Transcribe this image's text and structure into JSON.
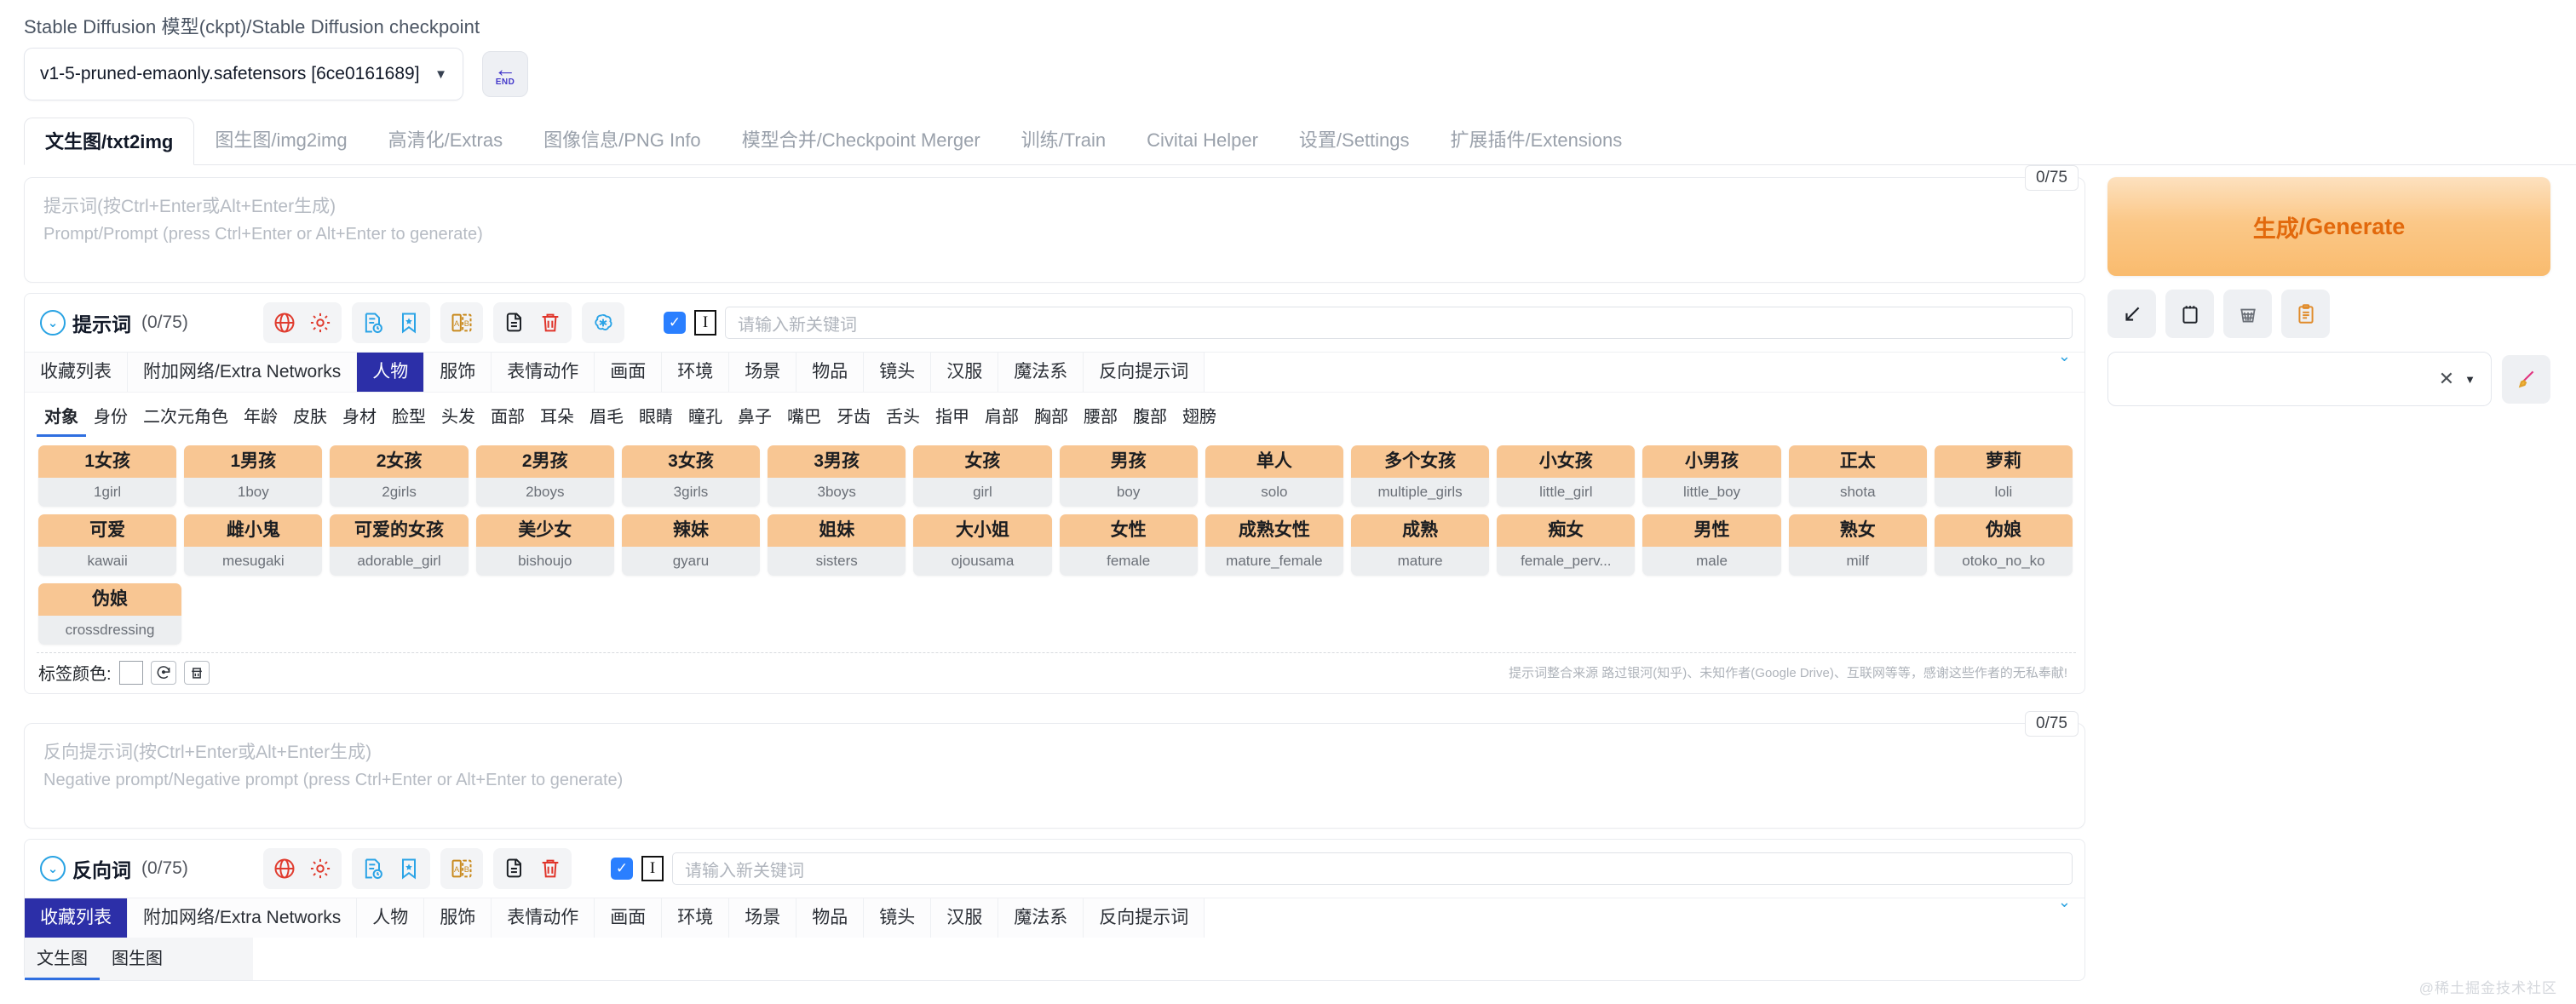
{
  "checkpoint": {
    "label": "Stable Diffusion 模型(ckpt)/Stable Diffusion checkpoint",
    "value": "v1-5-pruned-emaonly.safetensors [6ce0161689]",
    "caret": "▼",
    "end_button": {
      "arrow": "←",
      "text": "END"
    }
  },
  "main_tabs": [
    {
      "label": "文生图/txt2img",
      "active": true
    },
    {
      "label": "图生图/img2img",
      "active": false
    },
    {
      "label": "高清化/Extras",
      "active": false
    },
    {
      "label": "图像信息/PNG Info",
      "active": false
    },
    {
      "label": "模型合并/Checkpoint Merger",
      "active": false
    },
    {
      "label": "训练/Train",
      "active": false
    },
    {
      "label": "Civitai Helper",
      "active": false
    },
    {
      "label": "设置/Settings",
      "active": false
    },
    {
      "label": "扩展插件/Extensions",
      "active": false
    }
  ],
  "prompt": {
    "token_badge": "0/75",
    "placeholder_zh": "提示词(按Ctrl+Enter或Alt+Enter生成)",
    "placeholder_en": "Prompt/Prompt (press Ctrl+Enter or Alt+Enter to generate)",
    "value": ""
  },
  "negative_prompt": {
    "token_badge": "0/75",
    "placeholder_zh": "反向提示词(按Ctrl+Enter或Alt+Enter生成)",
    "placeholder_en": "Negative prompt/Negative prompt (press Ctrl+Enter or Alt+Enter to generate)",
    "value": ""
  },
  "prompt_panel": {
    "title": "提示词",
    "count": "(0/75)",
    "keyword_placeholder": "请输入新关键词",
    "keyword_value": "",
    "checkbox_checked": true
  },
  "negative_panel": {
    "title": "反向词",
    "count": "(0/75)",
    "keyword_placeholder": "请输入新关键词",
    "keyword_value": "",
    "checkbox_checked": true
  },
  "category_tabs": [
    {
      "label": "收藏列表",
      "active": false
    },
    {
      "label": "附加网络/Extra Networks",
      "active": false
    },
    {
      "label": "人物",
      "active": true
    },
    {
      "label": "服饰",
      "active": false
    },
    {
      "label": "表情动作",
      "active": false
    },
    {
      "label": "画面",
      "active": false
    },
    {
      "label": "环境",
      "active": false
    },
    {
      "label": "场景",
      "active": false
    },
    {
      "label": "物品",
      "active": false
    },
    {
      "label": "镜头",
      "active": false
    },
    {
      "label": "汉服",
      "active": false
    },
    {
      "label": "魔法系",
      "active": false
    },
    {
      "label": "反向提示词",
      "active": false
    }
  ],
  "negative_category_tabs": [
    {
      "label": "收藏列表",
      "active": true
    },
    {
      "label": "附加网络/Extra Networks",
      "active": false
    },
    {
      "label": "人物",
      "active": false
    },
    {
      "label": "服饰",
      "active": false
    },
    {
      "label": "表情动作",
      "active": false
    },
    {
      "label": "画面",
      "active": false
    },
    {
      "label": "环境",
      "active": false
    },
    {
      "label": "场景",
      "active": false
    },
    {
      "label": "物品",
      "active": false
    },
    {
      "label": "镜头",
      "active": false
    },
    {
      "label": "汉服",
      "active": false
    },
    {
      "label": "魔法系",
      "active": false
    },
    {
      "label": "反向提示词",
      "active": false
    }
  ],
  "sub_tabs": [
    {
      "label": "对象",
      "active": true
    },
    {
      "label": "身份",
      "active": false
    },
    {
      "label": "二次元角色",
      "active": false
    },
    {
      "label": "年龄",
      "active": false
    },
    {
      "label": "皮肤",
      "active": false
    },
    {
      "label": "身材",
      "active": false
    },
    {
      "label": "脸型",
      "active": false
    },
    {
      "label": "头发",
      "active": false
    },
    {
      "label": "面部",
      "active": false
    },
    {
      "label": "耳朵",
      "active": false
    },
    {
      "label": "眉毛",
      "active": false
    },
    {
      "label": "眼睛",
      "active": false
    },
    {
      "label": "瞳孔",
      "active": false
    },
    {
      "label": "鼻子",
      "active": false
    },
    {
      "label": "嘴巴",
      "active": false
    },
    {
      "label": "牙齿",
      "active": false
    },
    {
      "label": "舌头",
      "active": false
    },
    {
      "label": "指甲",
      "active": false
    },
    {
      "label": "肩部",
      "active": false
    },
    {
      "label": "胸部",
      "active": false
    },
    {
      "label": "腰部",
      "active": false
    },
    {
      "label": "腹部",
      "active": false
    },
    {
      "label": "翅膀",
      "active": false
    }
  ],
  "tag_rows": [
    [
      {
        "zh": "1女孩",
        "en": "1girl"
      },
      {
        "zh": "1男孩",
        "en": "1boy"
      },
      {
        "zh": "2女孩",
        "en": "2girls"
      },
      {
        "zh": "2男孩",
        "en": "2boys"
      },
      {
        "zh": "3女孩",
        "en": "3girls"
      },
      {
        "zh": "3男孩",
        "en": "3boys"
      },
      {
        "zh": "女孩",
        "en": "girl"
      },
      {
        "zh": "男孩",
        "en": "boy"
      },
      {
        "zh": "单人",
        "en": "solo"
      },
      {
        "zh": "多个女孩",
        "en": "multiple_girls"
      },
      {
        "zh": "小女孩",
        "en": "little_girl"
      },
      {
        "zh": "小男孩",
        "en": "little_boy"
      },
      {
        "zh": "正太",
        "en": "shota"
      },
      {
        "zh": "萝莉",
        "en": "loli"
      }
    ],
    [
      {
        "zh": "可爱",
        "en": "kawaii"
      },
      {
        "zh": "雌小鬼",
        "en": "mesugaki"
      },
      {
        "zh": "可爱的女孩",
        "en": "adorable_girl"
      },
      {
        "zh": "美少女",
        "en": "bishoujo"
      },
      {
        "zh": "辣妹",
        "en": "gyaru"
      },
      {
        "zh": "姐妹",
        "en": "sisters"
      },
      {
        "zh": "大小姐",
        "en": "ojousama"
      },
      {
        "zh": "女性",
        "en": "female"
      },
      {
        "zh": "成熟女性",
        "en": "mature_female"
      },
      {
        "zh": "成熟",
        "en": "mature"
      },
      {
        "zh": "痴女",
        "en": "female_perv..."
      },
      {
        "zh": "男性",
        "en": "male"
      },
      {
        "zh": "熟女",
        "en": "milf"
      },
      {
        "zh": "伪娘",
        "en": "otoko_no_ko"
      }
    ],
    [
      {
        "zh": "伪娘",
        "en": "crossdressing"
      }
    ]
  ],
  "tag_footer": {
    "color_label": "标签颜色:",
    "swatch_color": "#ffffff",
    "reset_icon": "reset-icon",
    "clear_icon": "clear-icon",
    "credit": "提示词整合来源 路过银河(知乎)、未知作者(Google Drive)、互联网等等，感谢这些作者的无私奉献!"
  },
  "fav_subtabs": [
    {
      "label": "文生图",
      "active": true
    },
    {
      "label": "图生图",
      "active": false
    }
  ],
  "right_panel": {
    "generate_zh": "生成",
    "generate_en": "/Generate",
    "icons": [
      {
        "name": "arrow-down-left-icon"
      },
      {
        "name": "notepad-icon"
      },
      {
        "name": "wastebasket-icon"
      },
      {
        "name": "clipboard-icon"
      }
    ],
    "style_select_value": "",
    "style_clear": "✕",
    "style_caret": "▼",
    "brush_icon": "paintbrush-icon"
  },
  "toolbar_icons": [
    {
      "name": "globe-icon",
      "color": "#e03b2e",
      "group": 0
    },
    {
      "name": "gear-icon",
      "color": "#e03b2e",
      "group": 0
    },
    {
      "name": "history-doc-icon",
      "color": "#2aa3e6",
      "group": 1
    },
    {
      "name": "bookmark-star-icon",
      "color": "#2aa3e6",
      "group": 1
    },
    {
      "name": "translate-ab-icon",
      "color": "#c98a1e",
      "group": 2
    },
    {
      "name": "copy-icon",
      "color": "#1b1f24",
      "group": 3
    },
    {
      "name": "trash-icon",
      "color": "#e0342a",
      "group": 3
    },
    {
      "name": "openai-icon",
      "color": "#2aa3e6",
      "group": 4
    }
  ],
  "watermark": "@稀土掘金技术社区"
}
